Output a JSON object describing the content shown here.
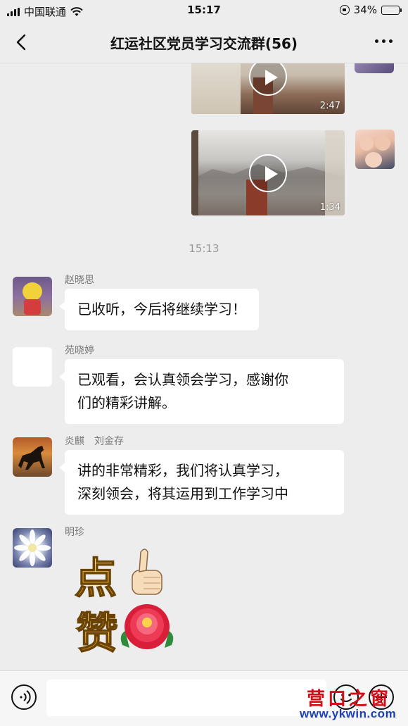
{
  "status_bar": {
    "carrier": "中国联通",
    "time": "15:17",
    "battery": "34%",
    "battery_level": 0.34
  },
  "header": {
    "title": "红运社区党员学习交流群(56)"
  },
  "videos": [
    {
      "duration": "2:47"
    },
    {
      "duration": "1:34"
    }
  ],
  "time_divider": "15:13",
  "messages": [
    {
      "sender": "赵晓思",
      "text": "已收听，今后将继续学习！"
    },
    {
      "sender": "苑晓婷",
      "text_lines": [
        "已观看，会认真领会学习，感谢你",
        "们的精彩讲解。"
      ]
    },
    {
      "sender": "炎麒　刘金存",
      "text_lines": [
        "讲的非常精彩，我们将认真学习，",
        "深刻领会，将其运用到工作学习中"
      ]
    },
    {
      "sender": "明珍",
      "sticker": "点赞"
    }
  ],
  "input_bar": {
    "placeholder": ""
  },
  "watermark": {
    "title": "营口之窗",
    "url": "www.ykwin.com"
  }
}
